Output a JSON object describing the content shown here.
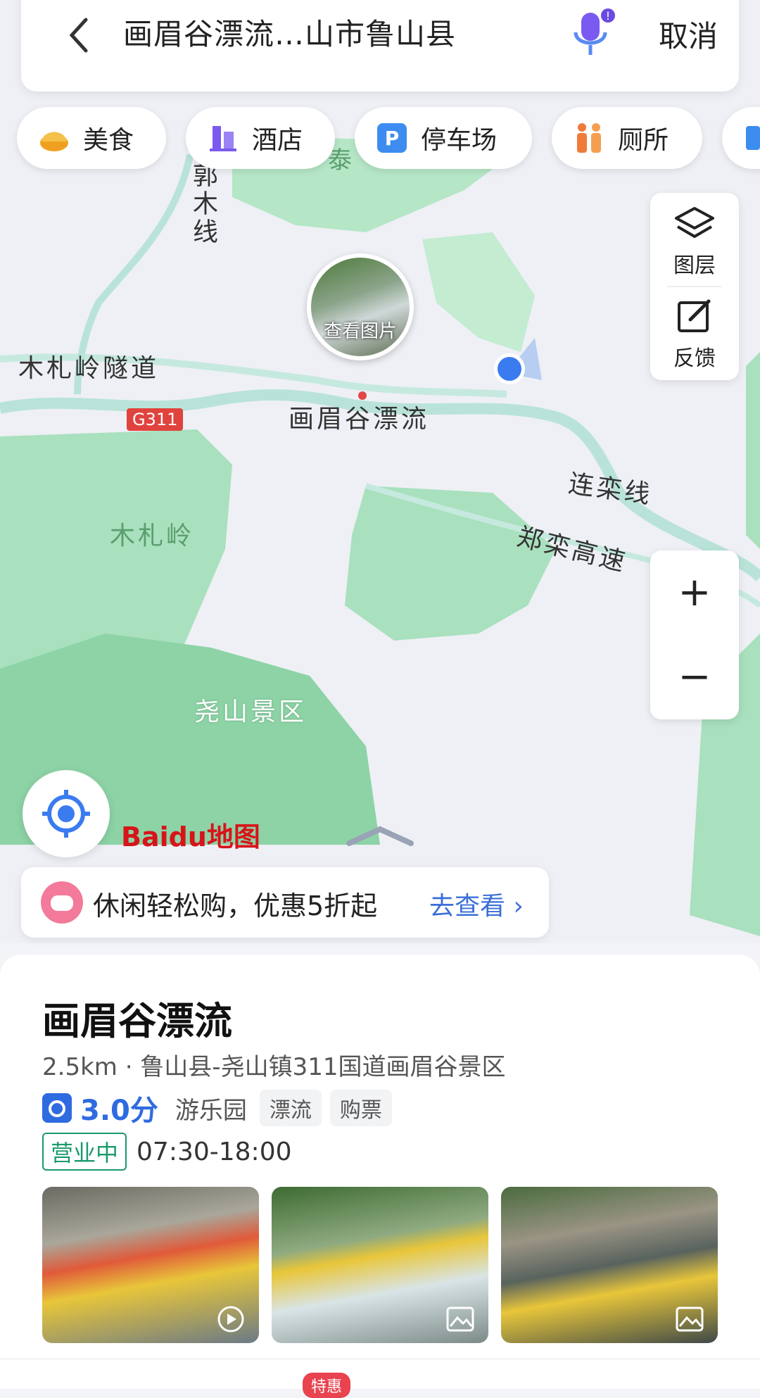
{
  "search": {
    "back_label": "<",
    "query": "画眉谷漂流…山市鲁山县",
    "cancel_label": "取消"
  },
  "categories": [
    {
      "label": "美食",
      "icon": "food-icon"
    },
    {
      "label": "酒店",
      "icon": "hotel-icon"
    },
    {
      "label": "停车场",
      "icon": "parking-icon"
    },
    {
      "label": "厕所",
      "icon": "toilet-icon"
    }
  ],
  "map_controls": {
    "layers_label": "图层",
    "feedback_label": "反馈",
    "zoom_in": "+",
    "zoom_out": "−"
  },
  "map_labels": {
    "road1": "木札岭隧道",
    "road2": "郭木线",
    "highway_badge": "G311",
    "poi": "画眉谷漂流",
    "view_photo": "查看图片",
    "line1": "连栾线",
    "line2": "郑栾高速",
    "area1": "木札岭",
    "area2": "尧山景区",
    "partial_top": "泰"
  },
  "logo": {
    "text": "Baidu地图"
  },
  "promo": {
    "text": "休闲轻松购，优惠5折起",
    "link": "去查看 ›"
  },
  "place": {
    "name": "画眉谷漂流",
    "distance_address": "2.5km  ·  鲁山县-尧山镇311国道画眉谷景区",
    "score": "3.0分",
    "category": "游乐园",
    "tags": [
      "漂流",
      "购票"
    ],
    "status": "营业中",
    "hours": "07:30-18:00"
  },
  "photos": [
    {
      "kind": "video",
      "icon": "play-icon"
    },
    {
      "kind": "image",
      "icon": "image-icon"
    },
    {
      "kind": "image",
      "icon": "image-icon"
    }
  ],
  "bottom": {
    "badge": "特惠"
  },
  "colors": {
    "accent": "#2f6be0",
    "open_green": "#1a9a6a",
    "map_green": "#a9e0bd",
    "road": "#b9e3d9"
  }
}
